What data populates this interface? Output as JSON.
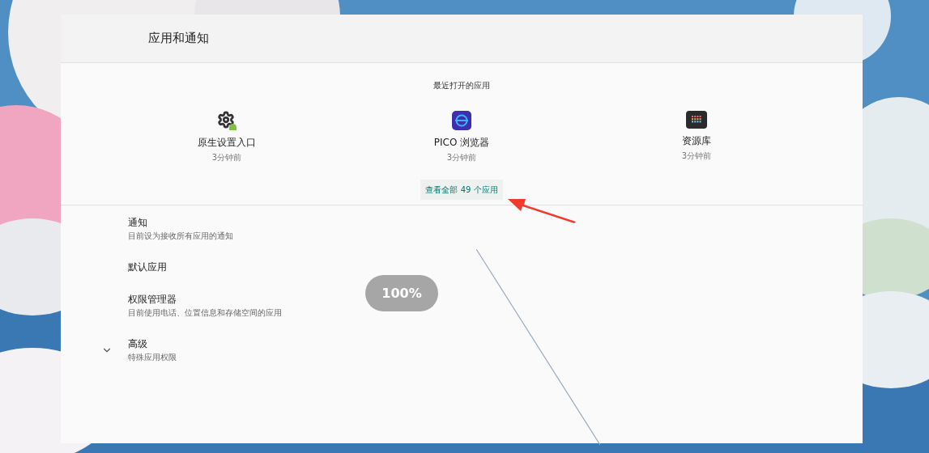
{
  "header": {
    "title": "应用和通知"
  },
  "recent_apps": {
    "title": "最近打开的应用",
    "apps": [
      {
        "kind": "settings",
        "name": "原生设置入口",
        "time": "3分钟前"
      },
      {
        "kind": "browser",
        "name": "PICO 浏览器",
        "time": "3分钟前"
      },
      {
        "kind": "library",
        "name": "资源库",
        "time": "3分钟前"
      }
    ],
    "see_all": "查看全部 49 个应用"
  },
  "items": [
    {
      "title": "通知",
      "subtitle": "目前设为接收所有应用的通知",
      "expandable": false
    },
    {
      "title": "默认应用",
      "expandable": false
    },
    {
      "title": "权限管理器",
      "subtitle": "目前使用电话、位置信息和存储空间的应用",
      "expandable": false
    },
    {
      "title": "高级",
      "subtitle": "特殊应用权限",
      "expandable": true
    }
  ],
  "toast": "100%"
}
